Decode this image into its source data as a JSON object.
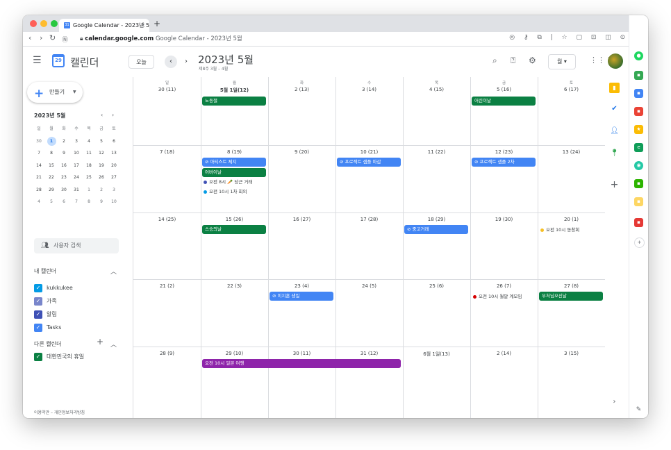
{
  "browser": {
    "tab_title": "Google Calendar - 2023년 5월",
    "tab_close": "×",
    "new_tab": "+",
    "url_host": "calendar.google.com",
    "url_rest": " Google Calendar - 2023년 5월"
  },
  "header": {
    "app_name": "캘린더",
    "logo_day": "29",
    "today": "오늘",
    "prev": "‹",
    "next": "›",
    "title": "2023년 5월",
    "subtitle": "제8주 3월 – 4월",
    "view": "월 ▾"
  },
  "sidebar": {
    "create": "만들기",
    "mini_title": "2023년 5월",
    "mini_dow": [
      "일",
      "월",
      "화",
      "수",
      "목",
      "금",
      "토"
    ],
    "mini_weeks": [
      [
        "30",
        "1",
        "2",
        "3",
        "4",
        "5",
        "6"
      ],
      [
        "7",
        "8",
        "9",
        "10",
        "11",
        "12",
        "13"
      ],
      [
        "14",
        "15",
        "16",
        "17",
        "18",
        "19",
        "20"
      ],
      [
        "21",
        "22",
        "23",
        "24",
        "25",
        "26",
        "27"
      ],
      [
        "28",
        "29",
        "30",
        "31",
        "1",
        "2",
        "3"
      ],
      [
        "4",
        "5",
        "6",
        "7",
        "8",
        "9",
        "10"
      ]
    ],
    "search_people": "사용자 검색",
    "my_calendars_title": "내 캘린더",
    "my_calendars": [
      {
        "label": "kukkukee",
        "color": "#039be5"
      },
      {
        "label": "가족",
        "color": "#7986cb"
      },
      {
        "label": "알림",
        "color": "#3f51b5"
      },
      {
        "label": "Tasks",
        "color": "#4285f4"
      }
    ],
    "other_calendars_title": "다른 캘린더",
    "other_calendars": [
      {
        "label": "대한민국의 휴일",
        "color": "#0b8043"
      }
    ],
    "footer": "이용약관 – 개인정보처리방침"
  },
  "grid": {
    "dow": [
      "일",
      "월",
      "화",
      "수",
      "목",
      "금",
      "토"
    ],
    "weeks": [
      [
        "30 (11)",
        "5월 1일(12)",
        "2 (13)",
        "3 (14)",
        "4 (15)",
        "5 (16)",
        "6 (17)"
      ],
      [
        "7 (18)",
        "8 (19)",
        "9 (20)",
        "10 (21)",
        "11 (22)",
        "12 (23)",
        "13 (24)"
      ],
      [
        "14 (25)",
        "15 (26)",
        "16 (27)",
        "17 (28)",
        "18 (29)",
        "19 (30)",
        "20 (1)"
      ],
      [
        "21 (2)",
        "22 (3)",
        "23 (4)",
        "24 (5)",
        "25 (6)",
        "26 (7)",
        "27 (8)"
      ],
      [
        "28 (9)",
        "29 (10)",
        "30 (11)",
        "31 (12)",
        "6월 1일(13)",
        "2 (14)",
        "3 (15)"
      ]
    ],
    "events": {
      "labor_day": "노동절",
      "childrens_day": "어린이날",
      "artist_fee": "⊘ 아티스트 체지",
      "proj_sample_deadline": "⊘ 프로젝트 샘플 마감",
      "proj_sample_2": "⊘ 프로젝트 샘플 2차",
      "parents_day": "어버이날",
      "carrot_trade": "오전 8시 🥕 당근 거래",
      "first_meeting": "오전 10시 1차 회의",
      "teachers_day": "스승의날",
      "used_trade": "⊘ 중고거래",
      "alumni": "오전 10시 동창회",
      "birthday": "⊘ 이지훈 생일",
      "monthly_meeting": "오전 10시 월말 계모임",
      "buddha_bday": "부처님오신날",
      "japan_trip": "오전 10시 일본 여행"
    }
  },
  "colors": {
    "holiday": "#0b8043",
    "task": "#4285f4",
    "trip": "#8e24aa",
    "dot_blue": "#3f51b5",
    "dot_cyan": "#039be5",
    "dot_yellow": "#f6bf26",
    "dot_red": "#d50000"
  }
}
